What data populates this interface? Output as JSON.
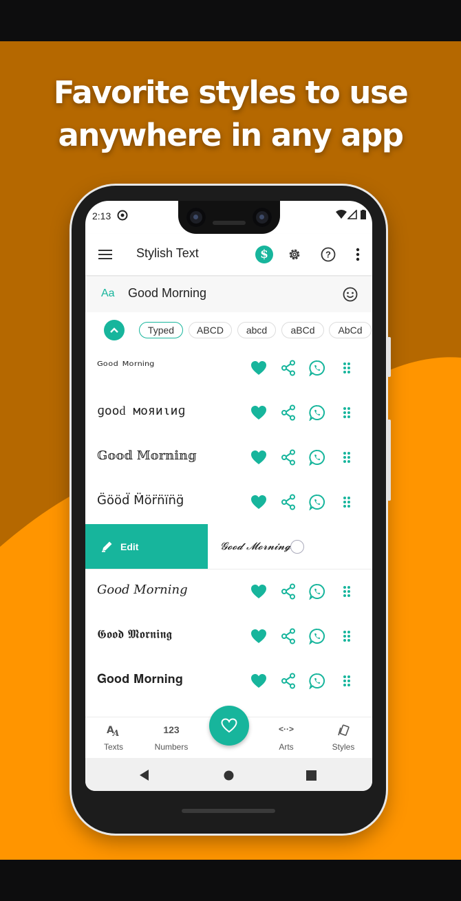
{
  "headline": {
    "line1": "Favorite styles to use",
    "line2": "anywhere in any app"
  },
  "status": {
    "time": "2:13"
  },
  "appbar": {
    "title": "Stylish Text"
  },
  "input": {
    "prefix": "Aa",
    "value": "Good Morning"
  },
  "chips": [
    {
      "label": "Typed",
      "active": true
    },
    {
      "label": "ABCD"
    },
    {
      "label": "abcd"
    },
    {
      "label": "aBCd"
    },
    {
      "label": "AbCd"
    }
  ],
  "rows": [
    {
      "text": "ᴳᵒᵒᵈ ᴹᵒʳⁿⁱⁿᵍ"
    },
    {
      "text": "ɡοοԁ мοяиιиɡ"
    },
    {
      "text": "𝔾𝕠𝕠𝕕 𝕄𝕠𝕣𝕟𝕚𝕟𝕘"
    },
    {
      "text": "G̈ööd̈ M̈ör̈n̈ïn̈g̈"
    },
    {
      "text": "𝓖𝓸𝓸𝓭 𝓜𝓸𝓻𝓷𝓲𝓷𝓰",
      "swiped": true
    },
    {
      "text": "𝐺𝑜𝑜𝑑 𝑀𝑜𝑟𝑛𝑖𝑛𝑔"
    },
    {
      "text": "𝕲𝖔𝖔𝖉 𝕸𝖔𝖗𝖓𝖎𝖓𝖌"
    },
    {
      "text": "𝐆𝐨𝐨𝐝 𝐌𝐨𝐫𝐧𝐢𝐧𝐠"
    }
  ],
  "swipe": {
    "edit_label": "Edit"
  },
  "nav": {
    "texts": {
      "icon": "AA",
      "label": "Texts"
    },
    "numbers": {
      "icon": "123",
      "label": "Numbers"
    },
    "arts": {
      "icon": "<··>",
      "label": "Arts"
    },
    "styles": {
      "label": "Styles"
    }
  },
  "colors": {
    "accent": "#17b59c",
    "banner_dark": "#b56800",
    "banner_light": "#ff9500"
  },
  "icons": [
    "menu-icon",
    "dollar-style-icon",
    "gear-icon",
    "help-icon",
    "more-vert-icon",
    "smiley-icon",
    "chevron-up-icon",
    "heart-icon",
    "share-icon",
    "whatsapp-icon",
    "drag-handle-icon",
    "pencil-icon",
    "radio-icon",
    "back-icon",
    "home-icon",
    "recents-icon"
  ]
}
